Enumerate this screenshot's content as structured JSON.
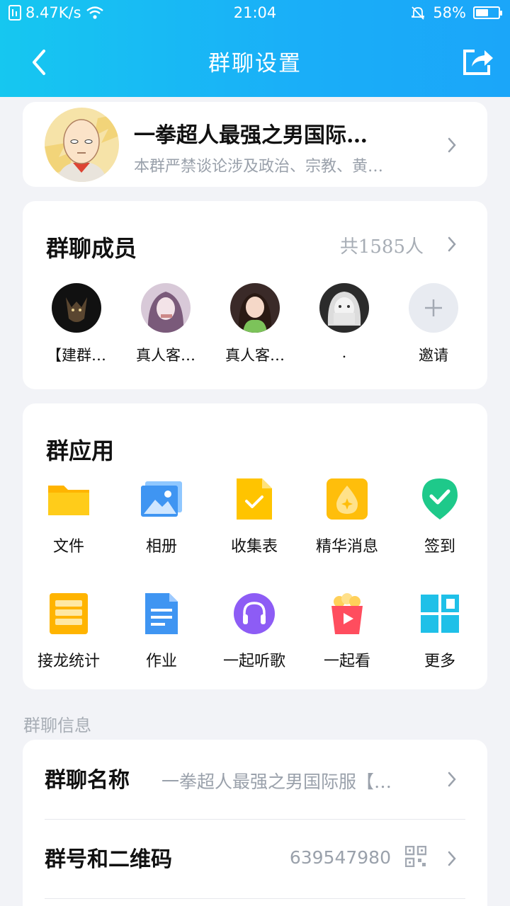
{
  "status_bar": {
    "network_speed": "8.47K/s",
    "time": "21:04",
    "battery": "58%",
    "battery_level": 0.58
  },
  "nav": {
    "title": "群聊设置",
    "back_icon": "chevron-left-icon",
    "share_icon": "share-icon"
  },
  "group": {
    "name": "一拳超人最强之男国际…",
    "description": "本群严禁谈论涉及政治、宗教、黄…"
  },
  "members": {
    "title": "群聊成员",
    "count": "共1585人",
    "list": [
      {
        "name": "【建群…"
      },
      {
        "name": "真人客…"
      },
      {
        "name": "真人客…"
      },
      {
        "name": "."
      }
    ],
    "invite_label": "邀请"
  },
  "apps": {
    "title": "群应用",
    "items": [
      {
        "label": "文件",
        "icon": "folder-icon"
      },
      {
        "label": "相册",
        "icon": "album-icon"
      },
      {
        "label": "收集表",
        "icon": "form-icon"
      },
      {
        "label": "精华消息",
        "icon": "essence-icon"
      },
      {
        "label": "签到",
        "icon": "checkin-icon"
      },
      {
        "label": "接龙统计",
        "icon": "relay-icon"
      },
      {
        "label": "作业",
        "icon": "homework-icon"
      },
      {
        "label": "一起听歌",
        "icon": "headphones-icon"
      },
      {
        "label": "一起看",
        "icon": "popcorn-icon"
      },
      {
        "label": "更多",
        "icon": "more-grid-icon"
      }
    ]
  },
  "info": {
    "section_label": "群聊信息",
    "name_key": "群聊名称",
    "name_value": "一拳超人最强之男国际服【…",
    "number_key": "群号和二维码",
    "number_value": "639547980"
  },
  "colors": {
    "header_start": "#16c7f0",
    "header_end": "#1ba6f9",
    "muted_text": "#9aa1ab"
  }
}
